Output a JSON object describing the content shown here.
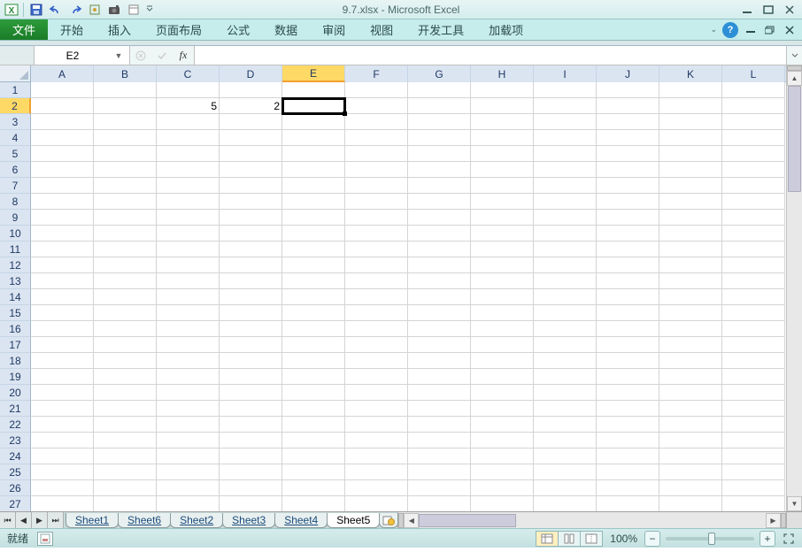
{
  "titlebar": {
    "title": "9.7.xlsx - Microsoft Excel"
  },
  "ribbon": {
    "file": "文件",
    "tabs": [
      "开始",
      "插入",
      "页面布局",
      "公式",
      "数据",
      "审阅",
      "视图",
      "开发工具",
      "加载项"
    ]
  },
  "formula": {
    "name_box": "E2",
    "fx_label": "fx",
    "value": ""
  },
  "grid": {
    "columns": [
      "A",
      "B",
      "C",
      "D",
      "E",
      "F",
      "G",
      "H",
      "I",
      "J",
      "K",
      "L"
    ],
    "row_count": 27,
    "active_col": "E",
    "active_row": 2,
    "cells": {
      "C2": "5",
      "D2": "2"
    }
  },
  "sheets": {
    "tabs": [
      "Sheet1",
      "Sheet6",
      "Sheet2",
      "Sheet3",
      "Sheet4",
      "Sheet5"
    ],
    "active": "Sheet5"
  },
  "status": {
    "ready": "就绪",
    "zoom": "100%"
  }
}
